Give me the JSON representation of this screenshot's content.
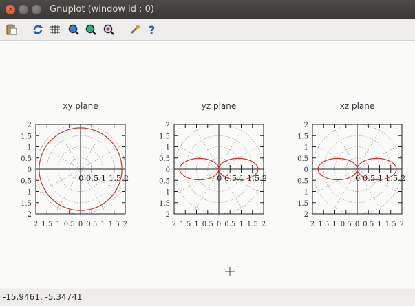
{
  "window": {
    "title": "Gnuplot (window id : 0)"
  },
  "toolbar": {
    "icons": [
      "clipboard-icon",
      "replot-icon",
      "grid-icon",
      "zoom-previous-icon",
      "zoom-next-icon",
      "unzoom-icon",
      "settings-icon",
      "help-icon"
    ]
  },
  "status": {
    "coords": "-15.9461, -5.34741"
  },
  "chart_data": [
    {
      "type": "line",
      "title": "xy plane",
      "xlim": [
        -2,
        2
      ],
      "ylim": [
        -2,
        2
      ],
      "xticks": [
        "2",
        "1.5",
        "1",
        "0.5",
        "0",
        "0.5",
        "1",
        "1.5",
        "2"
      ],
      "yticks": [
        "2",
        "1.5",
        "1",
        "0.5",
        "0",
        "0.5",
        "1",
        "1.5",
        "2"
      ],
      "rtick_labels": "0 0.5 1 1.5 2",
      "polar_grid": true,
      "series": [
        {
          "shape": "circle",
          "r": 1.85,
          "color": "#d9302a"
        }
      ]
    },
    {
      "type": "line",
      "title": "yz plane",
      "xlim": [
        -2,
        2
      ],
      "ylim": [
        -2,
        2
      ],
      "xticks": [
        "2",
        "1.5",
        "1",
        "0.5",
        "0",
        "0.5",
        "1",
        "1.5",
        "2"
      ],
      "yticks": [
        "2",
        "1.5",
        "1",
        "0.5",
        "0",
        "0.5",
        "1",
        "1.5",
        "2"
      ],
      "rtick_labels": "0 0.5 1 1.5 2",
      "polar_grid": true,
      "series": [
        {
          "shape": "dipole",
          "r": 1.75,
          "color": "#d9302a"
        }
      ]
    },
    {
      "type": "line",
      "title": "xz plane",
      "xlim": [
        -2,
        2
      ],
      "ylim": [
        -2,
        2
      ],
      "xticks": [
        "2",
        "1.5",
        "1",
        "0.5",
        "0",
        "0.5",
        "1",
        "1.5",
        "2"
      ],
      "yticks": [
        "2",
        "1.5",
        "1",
        "0.5",
        "0",
        "0.5",
        "1",
        "1.5",
        "2"
      ],
      "rtick_labels": "0 0.5 1 1.5 2",
      "polar_grid": true,
      "series": [
        {
          "shape": "dipole",
          "r": 1.75,
          "color": "#d9302a"
        }
      ]
    }
  ]
}
